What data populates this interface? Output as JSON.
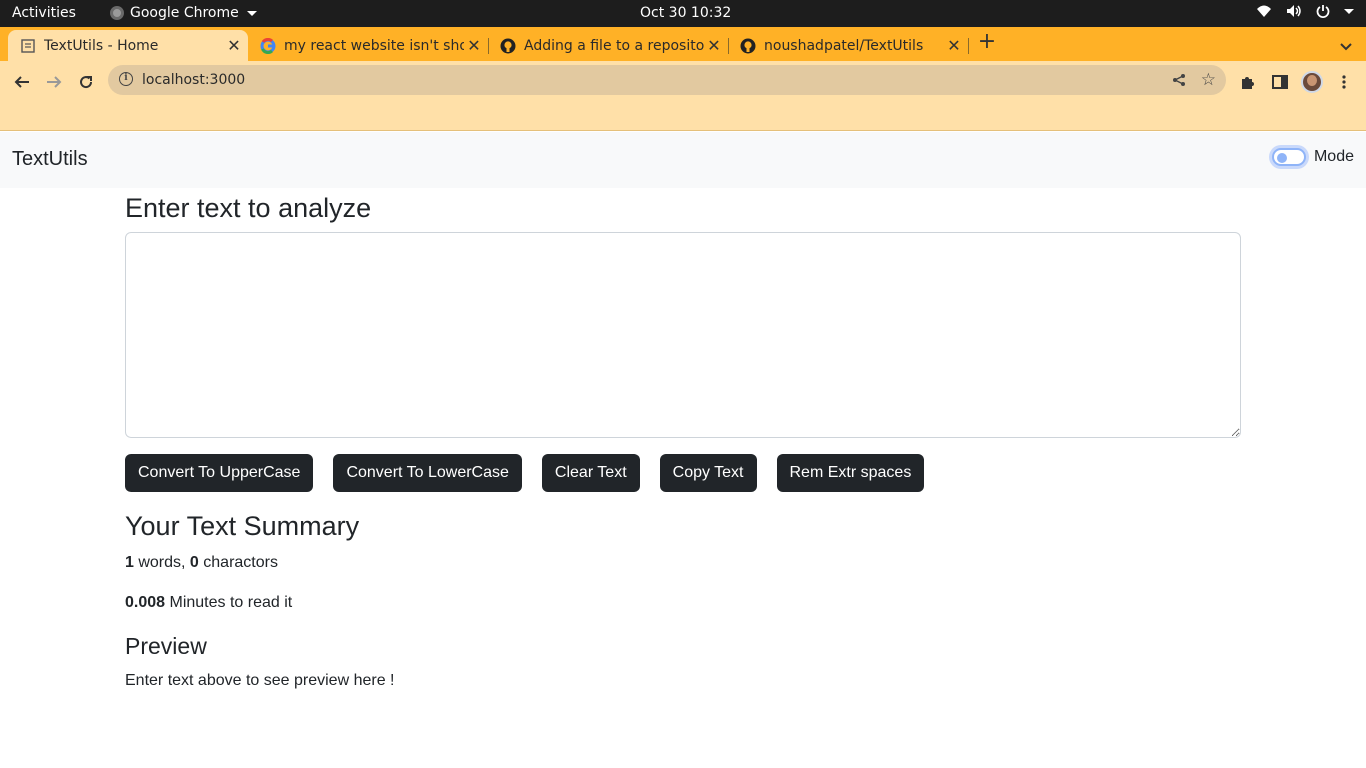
{
  "os": {
    "activities": "Activities",
    "app_name": "Google Chrome",
    "datetime": "Oct 30  10:32"
  },
  "browser": {
    "tabs": [
      {
        "title": "TextUtils - Home",
        "active": true
      },
      {
        "title": "my react website isn't sho",
        "active": false
      },
      {
        "title": "Adding a file to a reposito",
        "active": false
      },
      {
        "title": "noushadpatel/TextUtils",
        "active": false
      }
    ],
    "url": "localhost:3000",
    "accent_color": "#ffb126",
    "toolbar_color": "#ffe0a8"
  },
  "app": {
    "brand": "TextUtils",
    "mode_label": "Mode",
    "heading": "Enter text to analyze",
    "textarea_value": "",
    "buttons": {
      "upper": "Convert To UpperCase",
      "lower": "Convert To LowerCase",
      "clear": "Clear Text",
      "copy": "Copy Text",
      "spaces": "Rem Extr spaces"
    },
    "summary": {
      "heading": "Your Text Summary",
      "word_count": "1",
      "words_label": " words, ",
      "char_count": "0",
      "chars_label": " charactors",
      "minutes": "0.008",
      "minutes_label": " Minutes to read it"
    },
    "preview": {
      "heading": "Preview",
      "text": "Enter text above to see preview here !"
    }
  }
}
